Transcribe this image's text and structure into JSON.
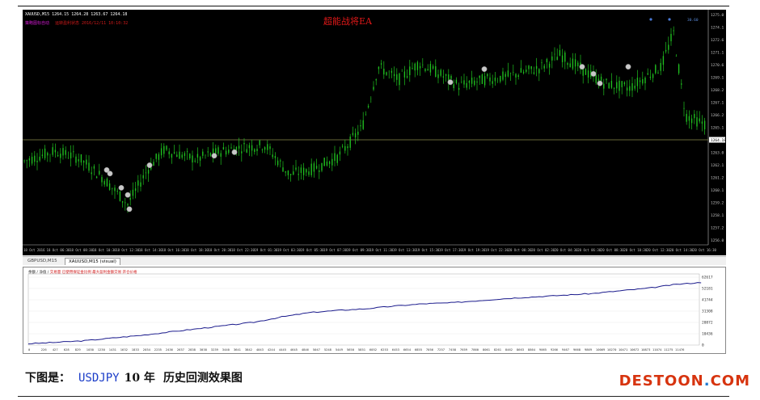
{
  "chart": {
    "symbol_label": "XAUUSD,M15  1264.15 1264.28 1263.67 1264.18",
    "ea_status_1": "策略图标自动",
    "ea_status_2": "运转盈利状态 2016/12/11 10:10:32",
    "ea_title": "超能战将EA",
    "colors": {
      "background": "#000000",
      "candles": "#1fbf1f",
      "ask_line": "#8a8a4a",
      "price_axis_text": "#c0c0c0",
      "trade_marker": "#c8c8c8",
      "ea_title": "#e01818"
    },
    "price_labels": [
      "1275.0",
      "1274.1",
      "1272.6",
      "1271.1",
      "1270.6",
      "1269.1",
      "1268.2",
      "1267.1",
      "1266.2",
      "1265.1",
      "1264.18",
      "1263.0",
      "1262.1",
      "1261.2",
      "1260.1",
      "1259.2",
      "1258.1",
      "1257.2",
      "1256.0"
    ],
    "current_price": "1264.18",
    "time_labels": [
      "18 Oct 2016",
      "18 Oct 06:30",
      "18 Oct 08:30",
      "18 Oct 10:30",
      "18 Oct 12:30",
      "18 Oct 14:30",
      "18 Oct 16:30",
      "18 Oct 18:30",
      "18 Oct 20:30",
      "18 Oct 22:30",
      "19 Oct 01:30",
      "19 Oct 03:30",
      "19 Oct 05:30",
      "19 Oct 07:30",
      "19 Oct 09:30",
      "19 Oct 11:30",
      "19 Oct 13:30",
      "19 Oct 15:30",
      "19 Oct 17:30",
      "19 Oct 19:30",
      "19 Oct 22:30",
      "20 Oct 00:30",
      "20 Oct 02:30",
      "20 Oct 04:30",
      "20 Oct 06:30",
      "20 Oct 08:30",
      "20 Oct 10:30",
      "20 Oct 12:30",
      "20 Oct 14:30",
      "20 Oct 16:30"
    ],
    "top_right_labels": [
      "1275.0",
      "30.60"
    ],
    "trade_marker_icon": "trade-arrow-icon"
  },
  "tabs": {
    "items": [
      "GBPUSD,M15",
      "XAUUSD,M15 (visual)"
    ],
    "active": "XAUUSD,M15 (visual)"
  },
  "report": {
    "legend_green": "余额 / 净值 /",
    "legend_red": "交易量  已使用保证金比例  最大盈利金额交易  开仓价格",
    "y_labels": [
      "62617",
      "52181",
      "41744",
      "31308",
      "20872",
      "10436",
      "0"
    ],
    "x_labels": [
      "0",
      "226",
      "427",
      "628",
      "829",
      "1030",
      "1230",
      "1431",
      "1632",
      "1833",
      "2034",
      "2235",
      "2436",
      "2637",
      "2838",
      "3038",
      "3239",
      "3440",
      "3641",
      "3842",
      "4043",
      "4244",
      "4445",
      "4645",
      "4846",
      "5047",
      "5248",
      "5449",
      "5650",
      "5851",
      "6052",
      "6253",
      "6453",
      "6654",
      "6855",
      "7056",
      "7257",
      "7458",
      "7659",
      "7860",
      "8061",
      "8261",
      "8462",
      "8663",
      "8864",
      "9065",
      "9266",
      "9467",
      "9668",
      "9869",
      "10069",
      "10270",
      "10471",
      "10672",
      "10873",
      "11074",
      "11275",
      "11476"
    ],
    "line_color": "#1a1a8c"
  },
  "caption": {
    "prefix": "下图是：",
    "symbol": "USDJPY",
    "years": "10 年",
    "rest": "历史回测效果图"
  },
  "logo": {
    "main": "DESTOON",
    "dot": ".",
    "suffix": "COM"
  }
}
